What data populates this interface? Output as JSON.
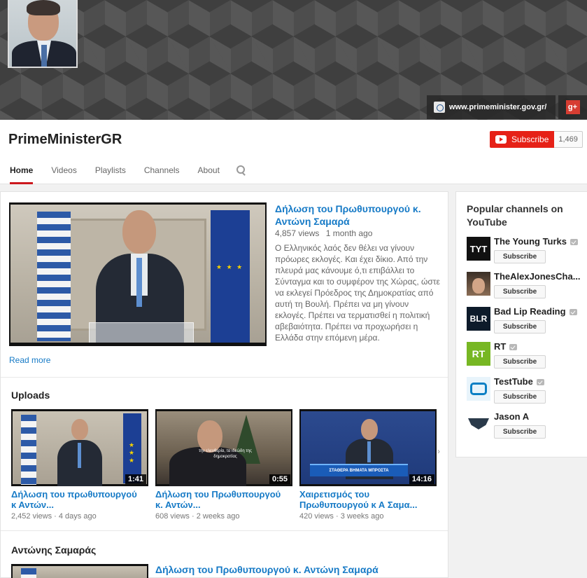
{
  "banner": {
    "site_link": "www.primeminister.gov.gr/",
    "gplus_label": "g+"
  },
  "header": {
    "channel_title": "PrimeMinisterGR",
    "subscribe_label": "Subscribe",
    "subscriber_count": "1,469",
    "tabs": [
      {
        "label": "Home",
        "active": true
      },
      {
        "label": "Videos"
      },
      {
        "label": "Playlists"
      },
      {
        "label": "Channels"
      },
      {
        "label": "About"
      }
    ]
  },
  "featured": {
    "title": "Δήλωση του Πρωθυπουργού κ. Αντώνη Σαμαρά",
    "views": "4,857 views",
    "age": "1 month ago",
    "description": "Ο Ελληνικός λαός δεν θέλει να γίνουν πρόωρες εκλογές. Και έχει δίκιο. Από την πλευρά μας κάνουμε ό,τι επιβάλλει το Σύνταγμα και το συμφέρον της Χώρας, ώστε να εκλεγεί Πρόεδρος της Δημοκρατίας από αυτή τη Βουλή. Πρέπει να μη γίνουν εκλογές. Πρέπει να τερματισθεί η πολιτική αβεβαιότητα. Πρέπει να προχωρήσει η Ελλάδα στην επόμενη μέρα.",
    "read_more": "Read more"
  },
  "uploads": {
    "title": "Uploads",
    "items": [
      {
        "title": "Δήλωση του πρωθυπουργού κ Αντών...",
        "views": "2,452 views",
        "age": "4 days ago",
        "duration": "1:41"
      },
      {
        "title": "Δήλωση του Πρωθυπουργού κ. Αντών...",
        "views": "608 views",
        "age": "2 weeks ago",
        "duration": "0:55",
        "caption": "την ελευθερία, τα ιδεώδη της δημοκρατίας"
      },
      {
        "title": "Χαιρετισμός του Πρωθυπουργού κ Α Σαμα...",
        "views": "420 views",
        "age": "3 weeks ago",
        "duration": "14:16",
        "banner_text": "ΣΤΑΘΕΡΑ ΒΗΜΑΤΑ ΜΠΡΟΣΤΑ"
      }
    ]
  },
  "playlist_section": {
    "title": "Αντώνης Σαμαράς",
    "first_video_title": "Δήλωση του Πρωθυπουργού κ. Αντώνη Σαμαρά"
  },
  "sidebar": {
    "title": "Popular channels on YouTube",
    "subscribe_label": "Subscribe",
    "channels": [
      {
        "name": "The Young Turks",
        "verified": true,
        "logo_text": "TYT",
        "logo_color": "#111111"
      },
      {
        "name": "TheAlexJonesCha...",
        "verified": false,
        "logo_text": "",
        "logo_color": "#5a4a3c"
      },
      {
        "name": "Bad Lip Reading",
        "verified": true,
        "logo_text": "BLR",
        "logo_color": "#0d1b2a"
      },
      {
        "name": "RT",
        "verified": true,
        "logo_text": "RT",
        "logo_color": "#77b723"
      },
      {
        "name": "TestTube",
        "verified": true,
        "logo_text": "",
        "logo_color": "#0b7fc4"
      },
      {
        "name": "Jason A",
        "verified": false,
        "logo_text": "",
        "logo_color": "#ffffff"
      }
    ]
  },
  "colors": {
    "accent": "#cc181e",
    "link": "#167ac6",
    "subscribe": "#e62117"
  }
}
